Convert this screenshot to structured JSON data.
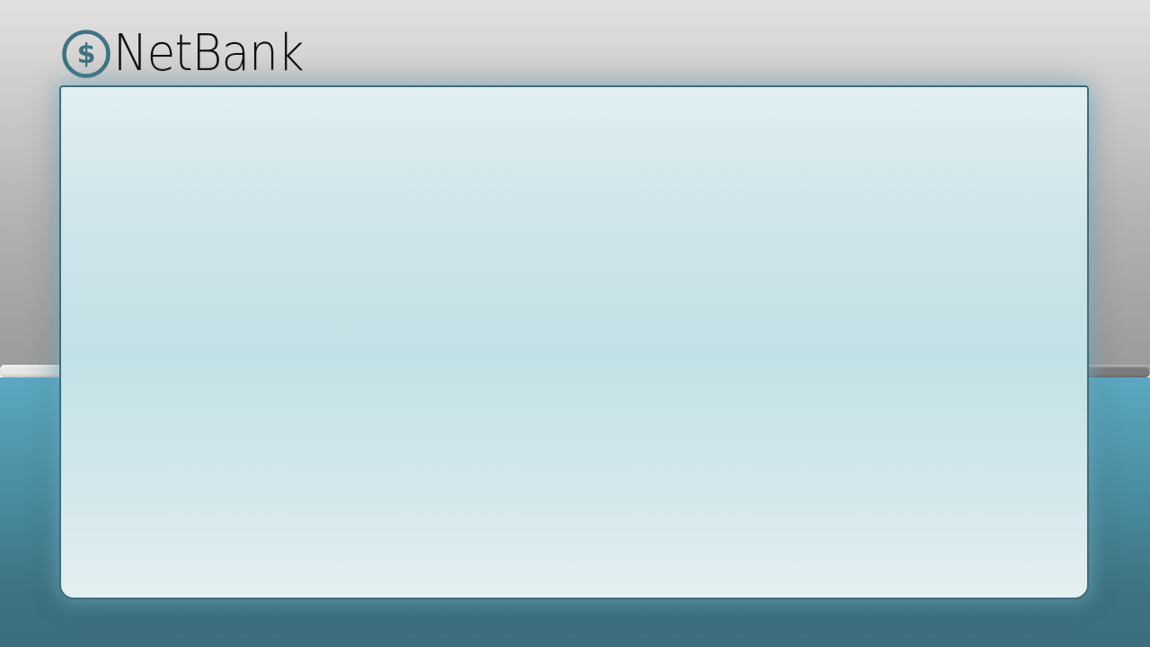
{
  "app": {
    "brand_name": "NetBank",
    "logo_icon": "dollar-circle-icon",
    "logo_symbol": "$"
  },
  "colors": {
    "brand_teal": "#3f7385",
    "panel_border": "#3f6c7b",
    "panel_fill": "#c9e3e8",
    "background_gray": "#c9c8c7",
    "background_teal": "#4b8fa3"
  },
  "main_panel": {
    "content": ""
  }
}
